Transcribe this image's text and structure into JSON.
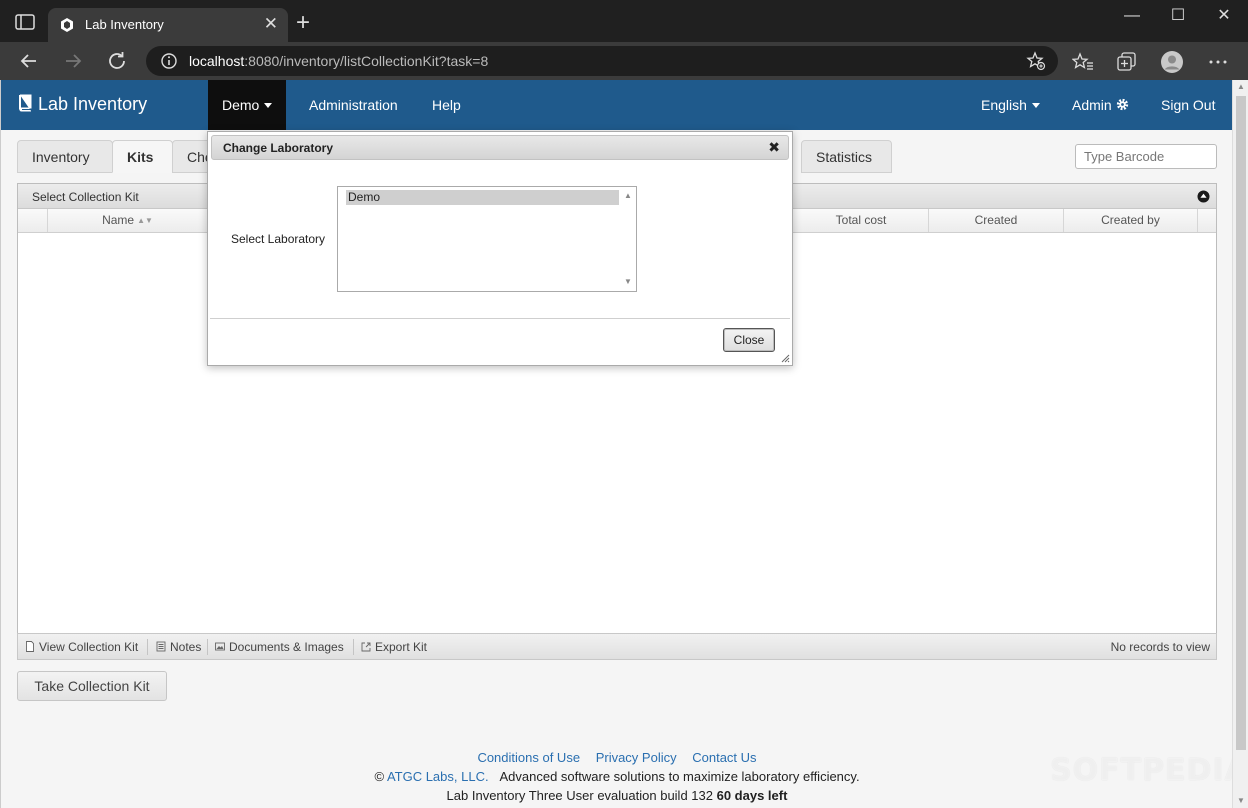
{
  "browser": {
    "tab_title": "Lab Inventory",
    "tab_close": "✕",
    "new_tab": "+",
    "url_host": "localhost",
    "url_rest": ":8080/inventory/listCollectionKit?task=8",
    "window_controls": {
      "minimize": "—",
      "maximize": "☐",
      "close": "✕"
    }
  },
  "navbar": {
    "brand": "Lab Inventory",
    "lab_menu": "Demo",
    "administration": "Administration",
    "help": "Help",
    "language": "English",
    "admin": "Admin",
    "sign_out": "Sign Out"
  },
  "tabs": [
    {
      "label": "Inventory",
      "selected": false
    },
    {
      "label": "Kits",
      "selected": true
    },
    {
      "label": "Che",
      "selected": false
    },
    {
      "label": "Statistics",
      "selected": false
    }
  ],
  "barcode": {
    "placeholder": "Type Barcode"
  },
  "grid": {
    "caption": "Select Collection Kit",
    "columns": {
      "name": "Name",
      "total_cost": "Total cost",
      "created": "Created",
      "created_by": "Created by"
    },
    "sort_icon": "▲▼"
  },
  "pager": {
    "view": "View Collection Kit",
    "notes": "Notes",
    "documents": "Documents & Images",
    "export": "Export Kit",
    "info": "No records to view"
  },
  "take_button": "Take Collection Kit",
  "footer": {
    "conditions": "Conditions of Use",
    "privacy": "Privacy Policy",
    "contact": "Contact Us",
    "copyright": "©",
    "company": "ATGC Labs, LLC.",
    "tagline": "Advanced software solutions to maximize laboratory efficiency.",
    "build": "Lab Inventory Three User evaluation build 132",
    "days_left": "60 days left"
  },
  "watermark": "SOFTPEDIA",
  "dialog": {
    "title": "Change Laboratory",
    "close_icon": "✖",
    "label": "Select Laboratory",
    "options": [
      "Demo"
    ],
    "close_button": "Close"
  },
  "colors": {
    "navbar": "#1f5a8c",
    "active_nav": "#0e0e0e",
    "link": "#2a6fb0"
  }
}
